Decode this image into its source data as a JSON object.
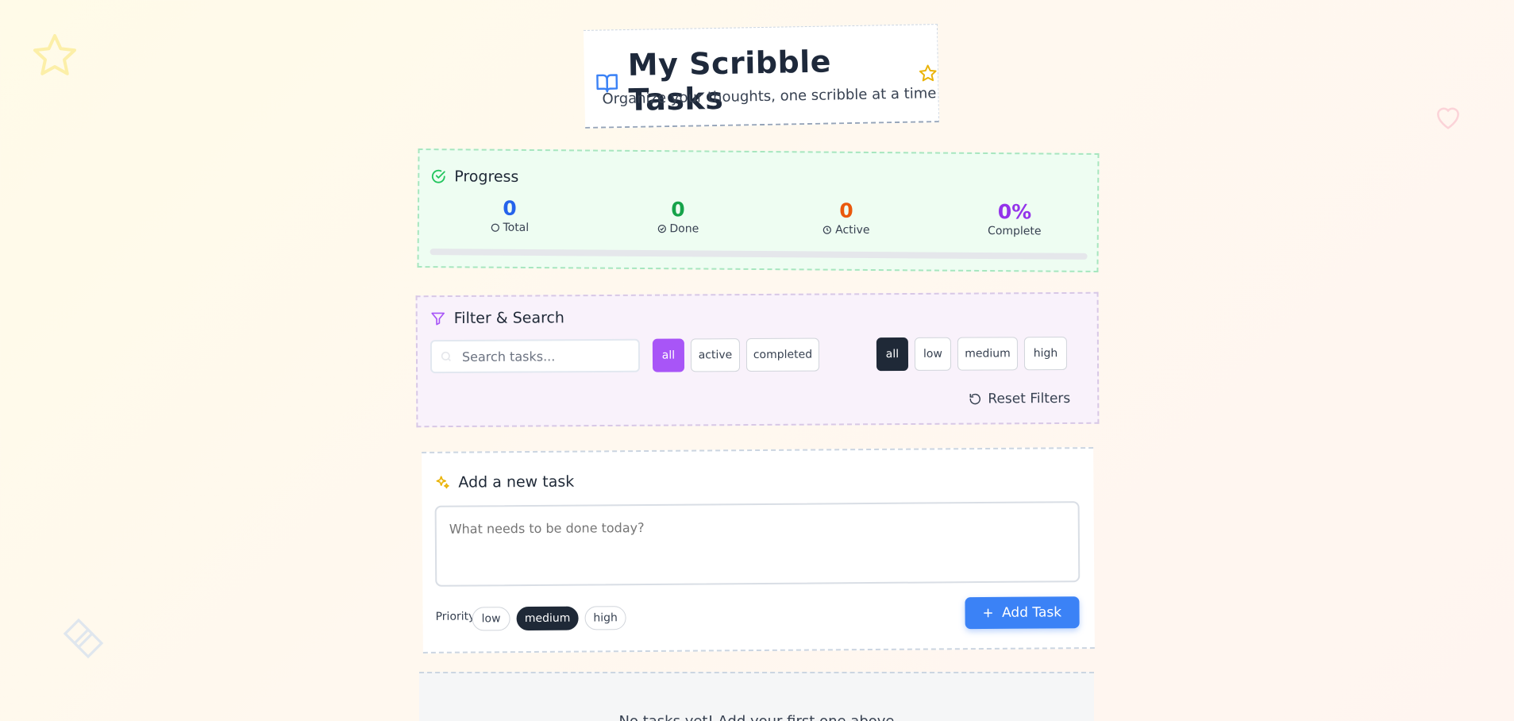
{
  "header": {
    "title": "My Scribble Tasks",
    "subtitle": "Organize your thoughts, one scribble at a time",
    "icons": [
      "book-icon",
      "star-icon"
    ]
  },
  "progress": {
    "heading": "Progress",
    "stats": [
      {
        "value": "0",
        "label": "Total",
        "color": "#2563eb",
        "icon": "circle-icon"
      },
      {
        "value": "0",
        "label": "Done",
        "color": "#16a34a",
        "icon": "check-circle-icon"
      },
      {
        "value": "0",
        "label": "Active",
        "color": "#ea580c",
        "icon": "clock-icon"
      },
      {
        "value": "0%",
        "label": "Complete",
        "color": "#9333ea"
      }
    ],
    "completion_fraction": 0
  },
  "filter": {
    "heading": "Filter & Search",
    "search_placeholder": "Search tasks...",
    "status_options": [
      "all",
      "active",
      "completed"
    ],
    "status_selected": "all",
    "priority_options": [
      "all",
      "low",
      "medium",
      "high"
    ],
    "priority_selected": "all",
    "reset_label": "Reset Filters"
  },
  "add_task": {
    "heading": "Add a new task",
    "placeholder": "What needs to be done today?",
    "priority_label": "Priority:",
    "priority_options": [
      "low",
      "medium",
      "high"
    ],
    "priority_selected": "medium",
    "button_label": "Add Task"
  },
  "empty_state": {
    "text": "No tasks yet! Add your first one above"
  },
  "colors": {
    "accent_blue": "#3b82f6",
    "accent_purple": "#a855f7",
    "dark": "#1f2937",
    "green": "#22c55e"
  }
}
